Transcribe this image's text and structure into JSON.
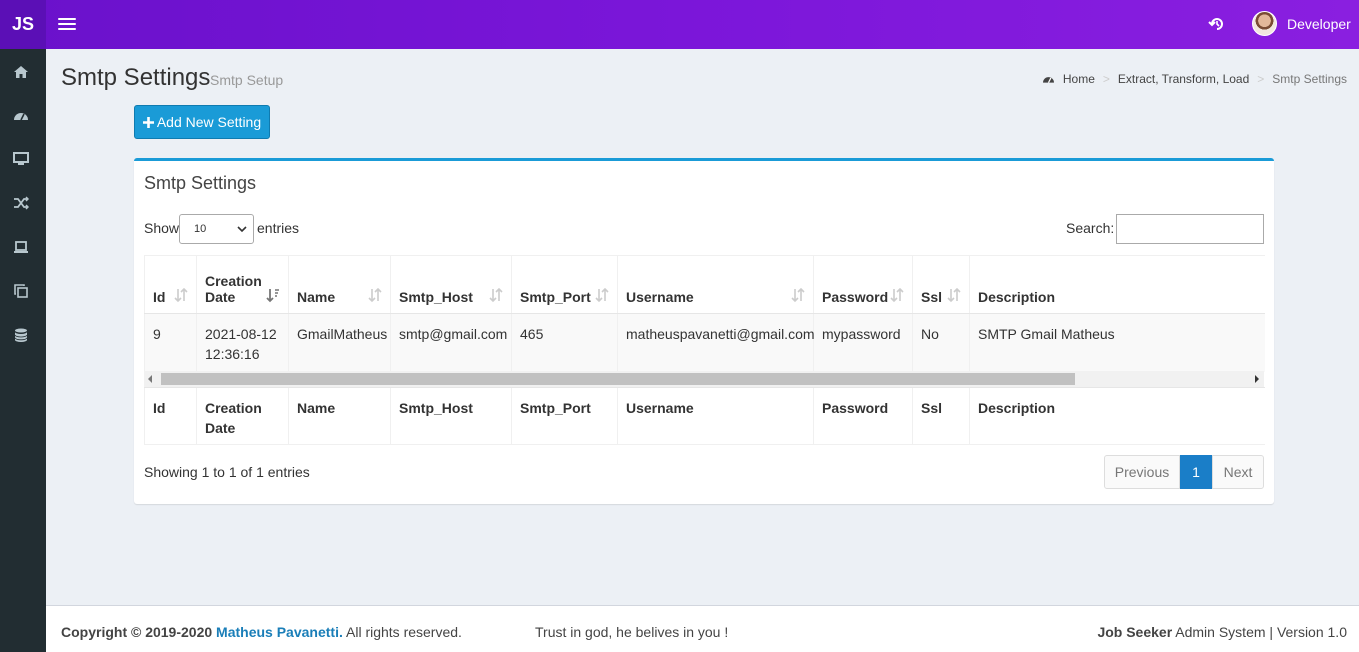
{
  "app": {
    "logo": "JS",
    "user_name": "Developer"
  },
  "header": {
    "title": "Smtp Settings",
    "subtitle": "Smtp Setup",
    "breadcrumb": [
      "Home",
      "Extract, Transform, Load",
      "Smtp Settings"
    ],
    "breadcrumb_sep": ">"
  },
  "sidebar": {
    "items": [
      "home-icon",
      "dashboard-icon",
      "desktop-icon",
      "random-icon",
      "laptop-icon",
      "copy-icon",
      "database-icon"
    ]
  },
  "actions": {
    "add_label": "Add New Setting"
  },
  "box": {
    "title": "Smtp Settings",
    "show_label": "Show",
    "entries_label": "entries",
    "page_length": "10",
    "search_label": "Search:",
    "search_value": ""
  },
  "table": {
    "columns": [
      "Id",
      "Creation Date",
      "Name",
      "Smtp_Host",
      "Smtp_Port",
      "Username",
      "Password",
      "Ssl",
      "Description"
    ],
    "rows": [
      [
        "9",
        "2021-08-12 12:36:16",
        "GmailMatheus",
        "smtp@gmail.com",
        "465",
        "matheuspavanetti@gmail.com",
        "mypassword",
        "No",
        "SMTP Gmail Matheus"
      ]
    ],
    "info": "Showing 1 to 1 of 1 entries",
    "pagination": {
      "previous": "Previous",
      "current": "1",
      "next": "Next"
    }
  },
  "footer": {
    "copyright_prefix": "Copyright © 2019-2020",
    "author": "Matheus Pavanetti.",
    "rights": " All rights reserved.",
    "motto": "Trust in god, he belives in you !",
    "product": "Job Seeker",
    "version_text": " Admin System | Version 1.0"
  },
  "colors": {
    "topbar": "#6a11cb",
    "sidebar": "#222d32",
    "primary": "#1a9bd7",
    "page_active": "#1a7ec8"
  }
}
